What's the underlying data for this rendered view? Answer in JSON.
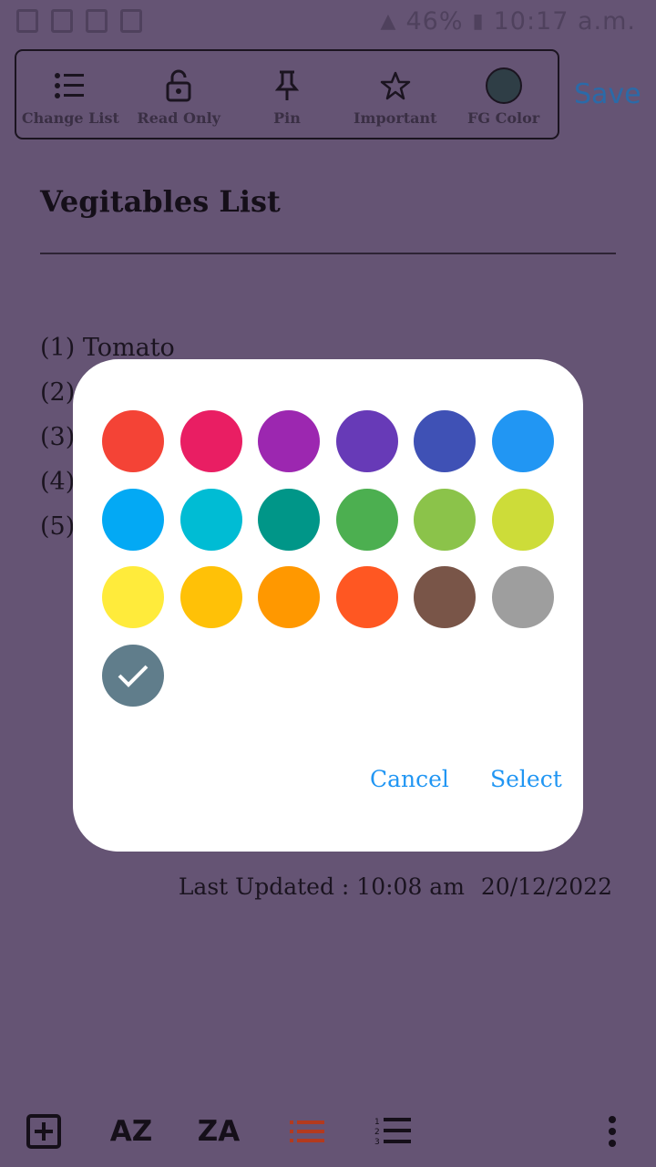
{
  "status_bar": {
    "battery": "46%",
    "time": "10:17 a.m."
  },
  "toolbar": {
    "items": [
      {
        "label": "Change List",
        "icon": "list-icon"
      },
      {
        "label": "Read Only",
        "icon": "unlock-icon"
      },
      {
        "label": "Pin",
        "icon": "pin-icon"
      },
      {
        "label": "Important",
        "icon": "star-icon"
      },
      {
        "label": "FG Color",
        "icon": "color-swatch",
        "color": "#2f3e46"
      }
    ],
    "save_label": "Save"
  },
  "note": {
    "title": "Vegitables List",
    "items": [
      "(1) Tomato",
      "(2)",
      "(3)",
      "(4)",
      "(5)"
    ],
    "last_updated_label": "Last Updated : 10:08 am",
    "last_updated_date": "20/12/2022"
  },
  "color_dialog": {
    "colors": [
      "#f44336",
      "#e91e63",
      "#9c27b0",
      "#673ab7",
      "#3f51b5",
      "#2196f3",
      "#03a9f4",
      "#00bcd4",
      "#009688",
      "#4caf50",
      "#8bc34a",
      "#cddc39",
      "#ffeb3b",
      "#ffc107",
      "#ff9800",
      "#ff5722",
      "#795548",
      "#9e9e9e",
      "#607d8b"
    ],
    "selected_index": 18,
    "cancel_label": "Cancel",
    "select_label": "Select"
  },
  "bottom_bar": {
    "add_icon": "add-box-icon",
    "sort_az_label": "AZ",
    "sort_za_label": "ZA",
    "bullet_list_icon": "bullet-list-icon",
    "numbered_list_icon": "numbered-list-icon",
    "more_icon": "more-vert-icon"
  },
  "theme": {
    "background": "#655474",
    "accent": "#2196f3",
    "save_color": "#2b6aa8",
    "bullet_active": "#b33a1e"
  }
}
